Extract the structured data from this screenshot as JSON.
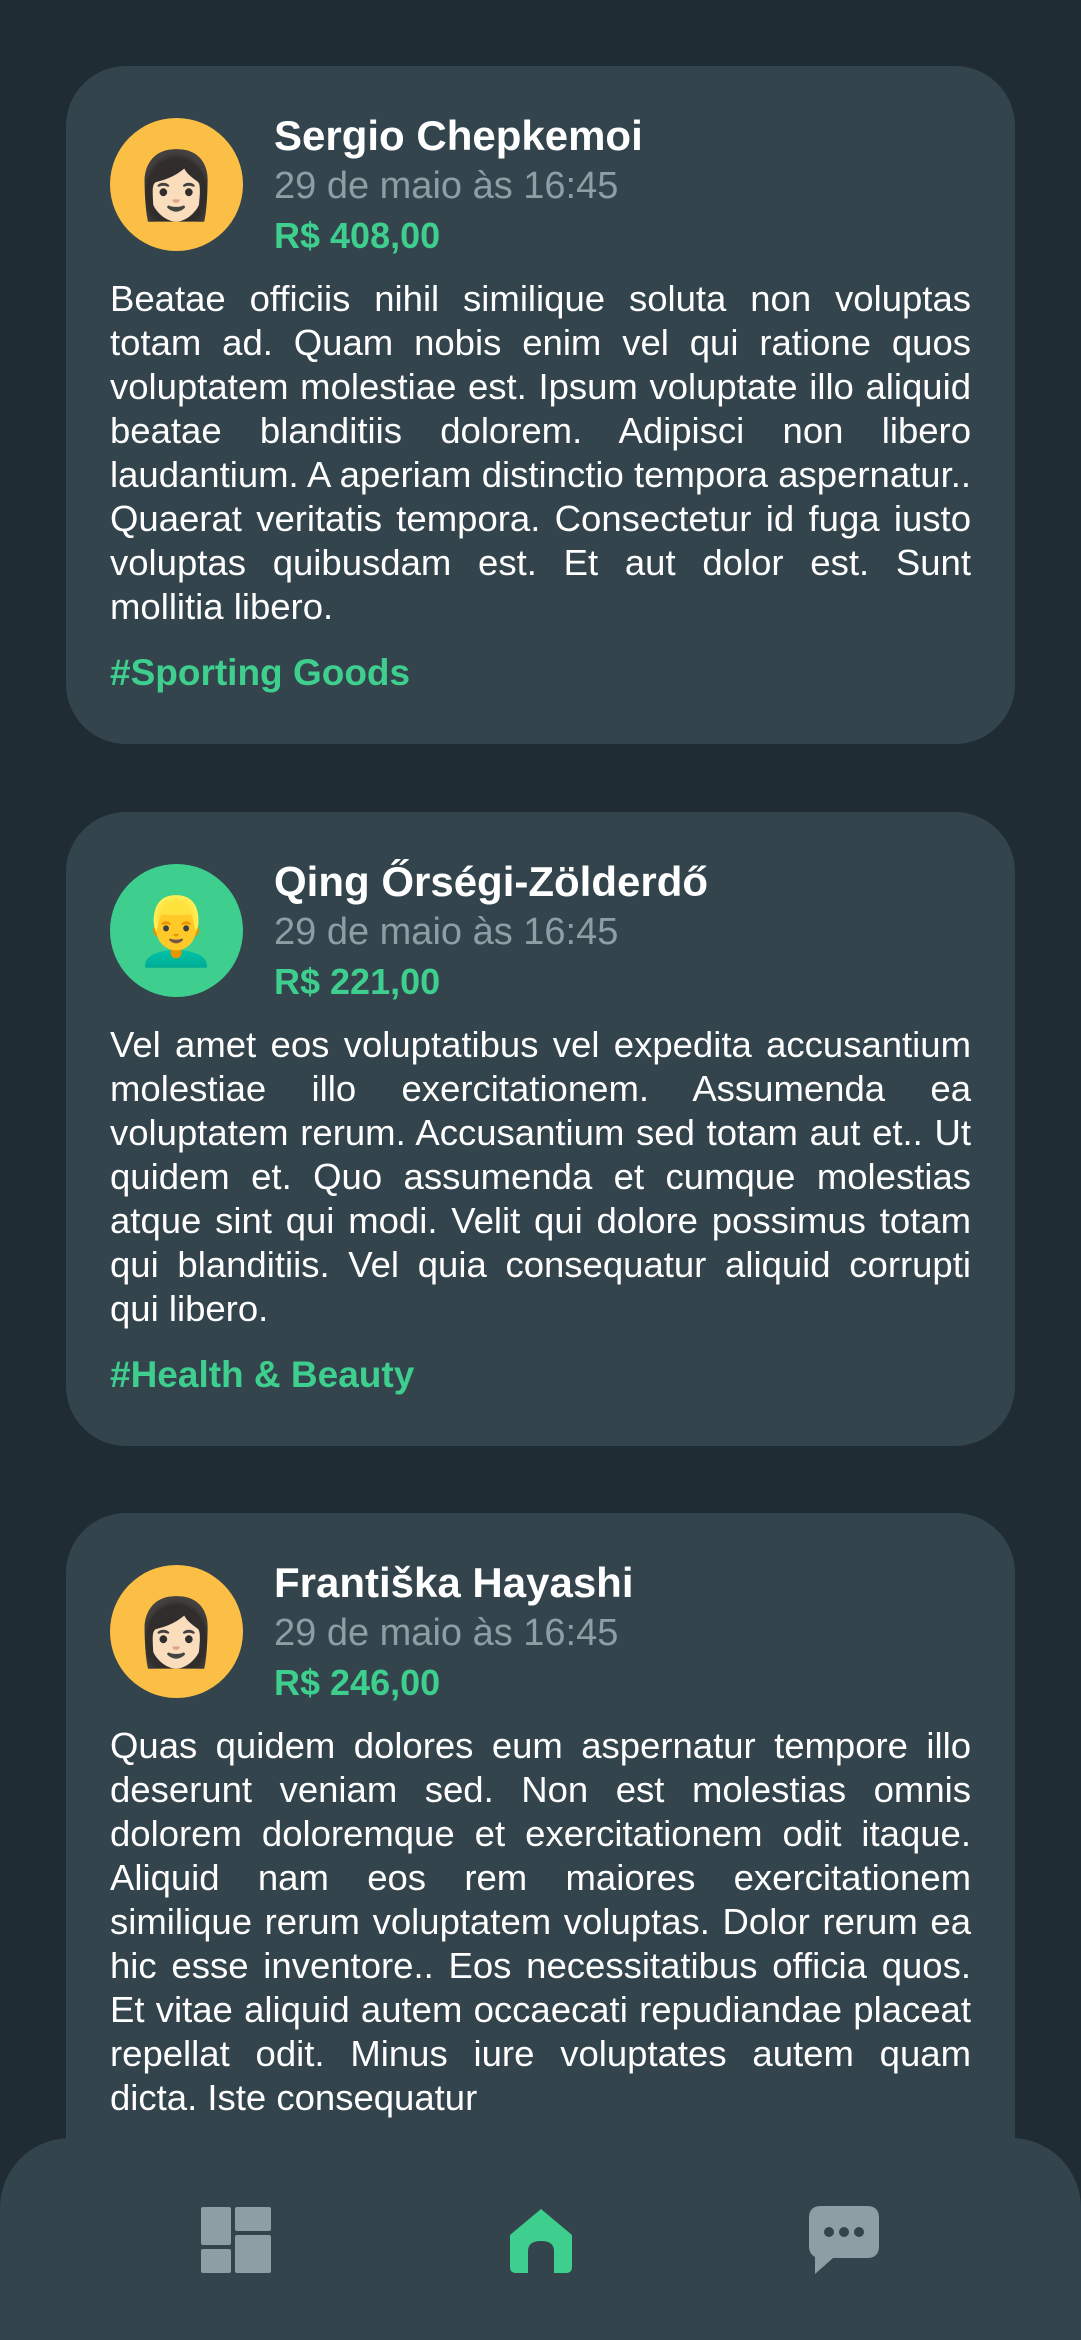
{
  "posts": [
    {
      "author": "Sergio Chepkemoi",
      "avatar_emoji": "👩🏻",
      "avatar_color": "#fbbf45",
      "date": "29 de maio às 16:45",
      "amount": "R$ 408,00",
      "text": "Beatae officiis nihil similique soluta non voluptas totam ad. Quam nobis enim vel qui ratione quos voluptatem molestiae est. Ipsum voluptate illo aliquid beatae blanditiis dolorem. Adipisci non libero laudantium. A aperiam distinctio tempora aspernatur.. Quaerat veritatis tempora. Consectetur id fuga iusto voluptas quibusdam est. Et aut dolor est. Sunt mollitia libero.",
      "tag": "#Sporting Goods"
    },
    {
      "author": "Qing Őrségi-Zölderdő",
      "avatar_emoji": "👱‍♂️",
      "avatar_color": "#3ecf8e",
      "date": "29 de maio às 16:45",
      "amount": "R$ 221,00",
      "text": "Vel amet eos voluptatibus vel expedita accusantium molestiae illo exercitationem. Assumenda ea voluptatem rerum. Accusantium sed totam aut et.. Ut quidem et. Quo assumenda et cumque molestias atque sint qui modi. Velit qui dolore possimus totam qui blanditiis. Vel quia consequatur aliquid corrupti qui libero.",
      "tag": "#Health & Beauty"
    },
    {
      "author": "Františka Hayashi",
      "avatar_emoji": "👩🏻",
      "avatar_color": "#fbbf45",
      "date": "29 de maio às 16:45",
      "amount": "R$ 246,00",
      "text": "Quas quidem dolores eum aspernatur tempore illo deserunt veniam sed. Non est molestias omnis dolorem doloremque et exercitationem odit itaque. Aliquid nam eos rem maiores exercitationem similique rerum voluptatem voluptas. Dolor rerum ea hic esse inventore.. Eos necessitatibus officia quos. Et vitae aliquid autem occaecati repudiandae placeat repellat odit. Minus iure voluptates autem quam dicta. Iste consequatur",
      "tag": ""
    }
  ],
  "nav": {
    "items": [
      {
        "icon": "dashboard-icon",
        "active": false
      },
      {
        "icon": "home-icon",
        "active": true
      },
      {
        "icon": "chat-icon",
        "active": false
      }
    ]
  },
  "colors": {
    "background": "#1f2c33",
    "card": "#33444d",
    "accent": "#3ecf8e",
    "inactive_icon": "#8d9ea5"
  }
}
